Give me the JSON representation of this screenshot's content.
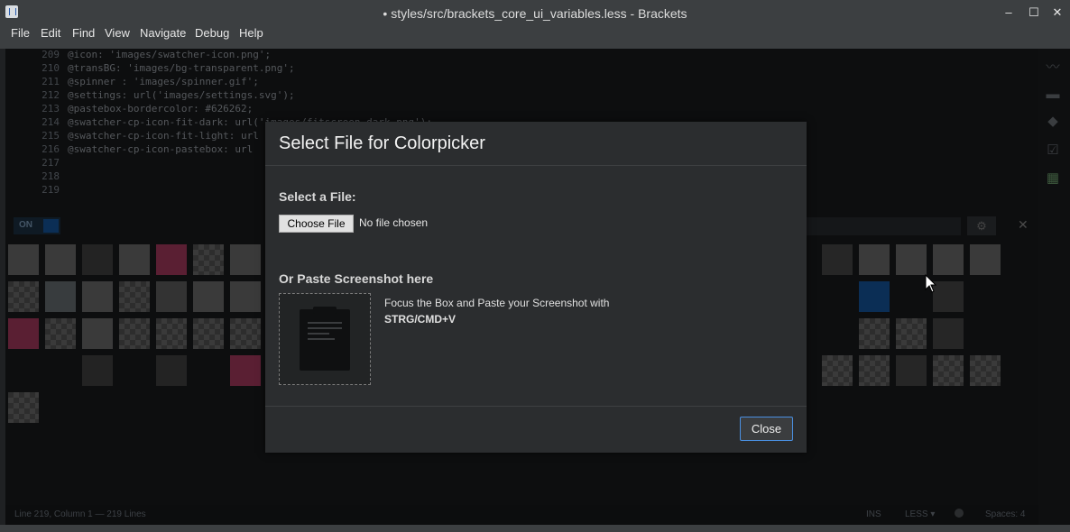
{
  "window": {
    "title": "• styles/src/brackets_core_ui_variables.less - Brackets",
    "minimize": "–",
    "maximize": "☐",
    "close": "✕"
  },
  "menu": [
    "File",
    "Edit",
    "Find",
    "View",
    "Navigate",
    "Debug",
    "Help"
  ],
  "code": {
    "lines": [
      {
        "num": "209",
        "text": "@icon: 'images/swatcher-icon.png';"
      },
      {
        "num": "210",
        "text": "@transBG: 'images/bg-transparent.png';"
      },
      {
        "num": "211",
        "text": "@spinner : 'images/spinner.gif';"
      },
      {
        "num": "212",
        "text": "@settings: url('images/settings.svg');"
      },
      {
        "num": "213",
        "text": "@pastebox-bordercolor: #626262;"
      },
      {
        "num": "214",
        "text": "@swatcher-cp-icon-fit-dark: url('images/fitscreen-dark.png');"
      },
      {
        "num": "215",
        "text": "@swatcher-cp-icon-fit-light: url"
      },
      {
        "num": "216",
        "text": "@swatcher-cp-icon-pastebox: url"
      },
      {
        "num": "217",
        "text": ""
      },
      {
        "num": "218",
        "text": ""
      },
      {
        "num": "219",
        "text": ""
      }
    ]
  },
  "panel": {
    "toggle_label": "ON",
    "gear_icon": "gear-icon",
    "close_label": "✕"
  },
  "status": {
    "position": "Line 219, Column 1",
    "lines": "— 219 Lines",
    "ins": "INS",
    "lang": "LESS ▾",
    "spaces": "Spaces: 4"
  },
  "dialog": {
    "title": "Select File for Colorpicker",
    "select_label": "Select a File:",
    "choose_button": "Choose File",
    "no_file": "No file chosen",
    "paste_label": "Or Paste Screenshot here",
    "paste_instruction": "Focus the Box and Paste your Screenshot with",
    "paste_keys": "STRG/CMD+V",
    "close_button": "Close"
  },
  "colors": {
    "accent": "#4a90e2",
    "dialog_bg": "#2b2d2f",
    "editor_bg": "#0d0e0f"
  }
}
